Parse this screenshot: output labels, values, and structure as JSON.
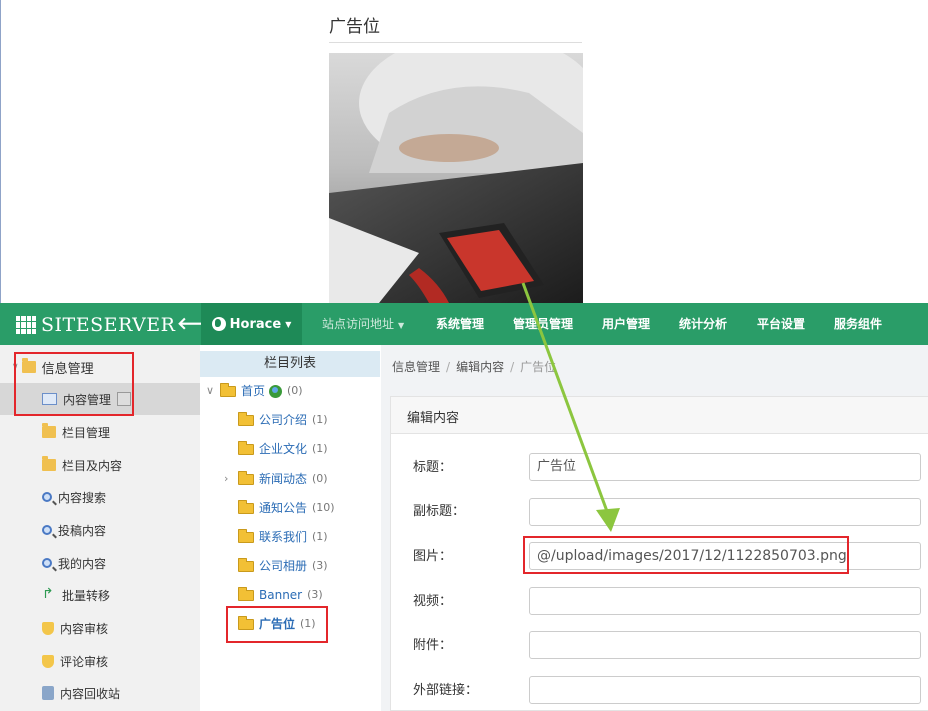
{
  "preview": {
    "title": "广告位"
  },
  "topbar": {
    "logo": "SITESERVER",
    "site": "Horace",
    "nav": [
      "站点访问地址",
      "系统管理",
      "管理员管理",
      "用户管理",
      "统计分析",
      "平台设置",
      "服务组件"
    ]
  },
  "sidebar": {
    "section": "信息管理",
    "items": [
      {
        "label": "内容管理",
        "icon": "page-icon"
      },
      {
        "label": "栏目管理",
        "icon": "folder-icon"
      },
      {
        "label": "栏目及内容",
        "icon": "folder-icon"
      },
      {
        "label": "内容搜索",
        "icon": "search-icon"
      },
      {
        "label": "投稿内容",
        "icon": "search-icon"
      },
      {
        "label": "我的内容",
        "icon": "search-icon"
      },
      {
        "label": "批量转移",
        "icon": "arrow-icon"
      },
      {
        "label": "内容审核",
        "icon": "shield-icon"
      },
      {
        "label": "评论审核",
        "icon": "shield-icon"
      },
      {
        "label": "内容回收站",
        "icon": "recycle-icon"
      }
    ]
  },
  "tree": {
    "header": "栏目列表",
    "root": {
      "label": "首页",
      "count": "(0)"
    },
    "items": [
      {
        "label": "公司介绍",
        "count": "(1)"
      },
      {
        "label": "企业文化",
        "count": "(1)"
      },
      {
        "label": "新闻动态",
        "count": "(0)"
      },
      {
        "label": "通知公告",
        "count": "(10)"
      },
      {
        "label": "联系我们",
        "count": "(1)"
      },
      {
        "label": "公司相册",
        "count": "(3)"
      },
      {
        "label": "Banner",
        "count": "(3)"
      },
      {
        "label": "广告位",
        "count": "(1)"
      }
    ]
  },
  "breadcrumb": [
    "信息管理",
    "编辑内容",
    "广告位"
  ],
  "panel": {
    "title": "编辑内容",
    "fields": [
      {
        "label": "标题：",
        "value": "广告位"
      },
      {
        "label": "副标题：",
        "value": ""
      },
      {
        "label": "图片：",
        "value": "@/upload/images/2017/12/1122850703.png"
      },
      {
        "label": "视频：",
        "value": ""
      },
      {
        "label": "附件：",
        "value": ""
      },
      {
        "label": "外部链接：",
        "value": ""
      }
    ]
  },
  "colors": {
    "topbar": "#2a9d68",
    "highlight": "#e3262b",
    "arrow": "#8cc63f"
  }
}
